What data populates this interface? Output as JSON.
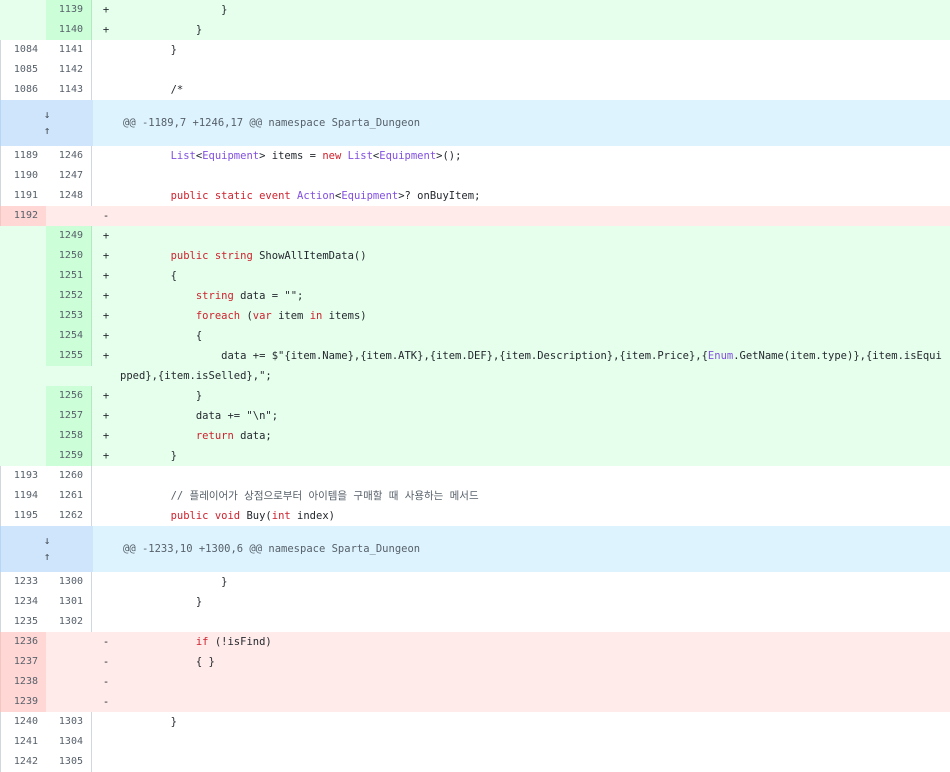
{
  "rows": [
    {
      "type": "added",
      "old": "",
      "new": "1139",
      "sign": "+",
      "code": "                }"
    },
    {
      "type": "added",
      "old": "",
      "new": "1140",
      "sign": "+",
      "code": "            }"
    },
    {
      "type": "ctx",
      "old": "1084",
      "new": "1141",
      "sign": "",
      "code": "        }"
    },
    {
      "type": "ctx",
      "old": "1085",
      "new": "1142",
      "sign": "",
      "code": ""
    },
    {
      "type": "ctx",
      "old": "1086",
      "new": "1143",
      "sign": "",
      "code": "        /*"
    },
    {
      "type": "hunk",
      "text": "@@ -1189,7 +1246,17 @@ namespace Sparta_Dungeon"
    },
    {
      "type": "ctx",
      "old": "1189",
      "new": "1246",
      "sign": "",
      "code": "        List<Equipment> items = new List<Equipment>();"
    },
    {
      "type": "ctx",
      "old": "1190",
      "new": "1247",
      "sign": "",
      "code": ""
    },
    {
      "type": "ctx",
      "old": "1191",
      "new": "1248",
      "sign": "",
      "code": "        public static event Action<Equipment>? onBuyItem;"
    },
    {
      "type": "removed",
      "old": "1192",
      "new": "",
      "sign": "-",
      "code": ""
    },
    {
      "type": "added",
      "old": "",
      "new": "1249",
      "sign": "+",
      "code": ""
    },
    {
      "type": "added",
      "old": "",
      "new": "1250",
      "sign": "+",
      "code": "        public string ShowAllItemData()"
    },
    {
      "type": "added",
      "old": "",
      "new": "1251",
      "sign": "+",
      "code": "        {"
    },
    {
      "type": "added",
      "old": "",
      "new": "1252",
      "sign": "+",
      "code": "            string data = \"\";"
    },
    {
      "type": "added",
      "old": "",
      "new": "1253",
      "sign": "+",
      "code": "            foreach (var item in items)"
    },
    {
      "type": "added",
      "old": "",
      "new": "1254",
      "sign": "+",
      "code": "            {"
    },
    {
      "type": "added",
      "old": "",
      "new": "1255",
      "sign": "+",
      "code": "                data += $\"{item.Name},{item.ATK},{item.DEF},{item.Description},{item.Price},{Enum.GetName(item.type)},{item.isEquipped},{item.isSelled},\";"
    },
    {
      "type": "added",
      "old": "",
      "new": "1256",
      "sign": "+",
      "code": "            }"
    },
    {
      "type": "added",
      "old": "",
      "new": "1257",
      "sign": "+",
      "code": "            data += \"\\n\";"
    },
    {
      "type": "added",
      "old": "",
      "new": "1258",
      "sign": "+",
      "code": "            return data;"
    },
    {
      "type": "added",
      "old": "",
      "new": "1259",
      "sign": "+",
      "code": "        }"
    },
    {
      "type": "ctx",
      "old": "1193",
      "new": "1260",
      "sign": "",
      "code": ""
    },
    {
      "type": "ctx",
      "old": "1194",
      "new": "1261",
      "sign": "",
      "code": "        // 플레이어가 상점으로부터 아이템을 구매할 때 사용하는 메서드"
    },
    {
      "type": "ctx",
      "old": "1195",
      "new": "1262",
      "sign": "",
      "code": "        public void Buy(int index)"
    },
    {
      "type": "hunk",
      "text": "@@ -1233,10 +1300,6 @@ namespace Sparta_Dungeon"
    },
    {
      "type": "ctx",
      "old": "1233",
      "new": "1300",
      "sign": "",
      "code": "                }"
    },
    {
      "type": "ctx",
      "old": "1234",
      "new": "1301",
      "sign": "",
      "code": "            }"
    },
    {
      "type": "ctx",
      "old": "1235",
      "new": "1302",
      "sign": "",
      "code": ""
    },
    {
      "type": "removed",
      "old": "1236",
      "new": "",
      "sign": "-",
      "code": "            if (!isFind)"
    },
    {
      "type": "removed",
      "old": "1237",
      "new": "",
      "sign": "-",
      "code": "            { }"
    },
    {
      "type": "removed",
      "old": "1238",
      "new": "",
      "sign": "-",
      "code": ""
    },
    {
      "type": "removed",
      "old": "1239",
      "new": "",
      "sign": "-",
      "code": ""
    },
    {
      "type": "ctx",
      "old": "1240",
      "new": "1303",
      "sign": "",
      "code": "        }"
    },
    {
      "type": "ctx",
      "old": "1241",
      "new": "1304",
      "sign": "",
      "code": ""
    },
    {
      "type": "ctx",
      "old": "1242",
      "new": "1305",
      "sign": "",
      "code": ""
    }
  ],
  "icons": {
    "expand_down": "↓",
    "expand_up": "↑"
  },
  "colors": {
    "added_bg": "#e6ffec",
    "removed_bg": "#ffebe9",
    "hunk_bg": "#ddf4ff"
  }
}
